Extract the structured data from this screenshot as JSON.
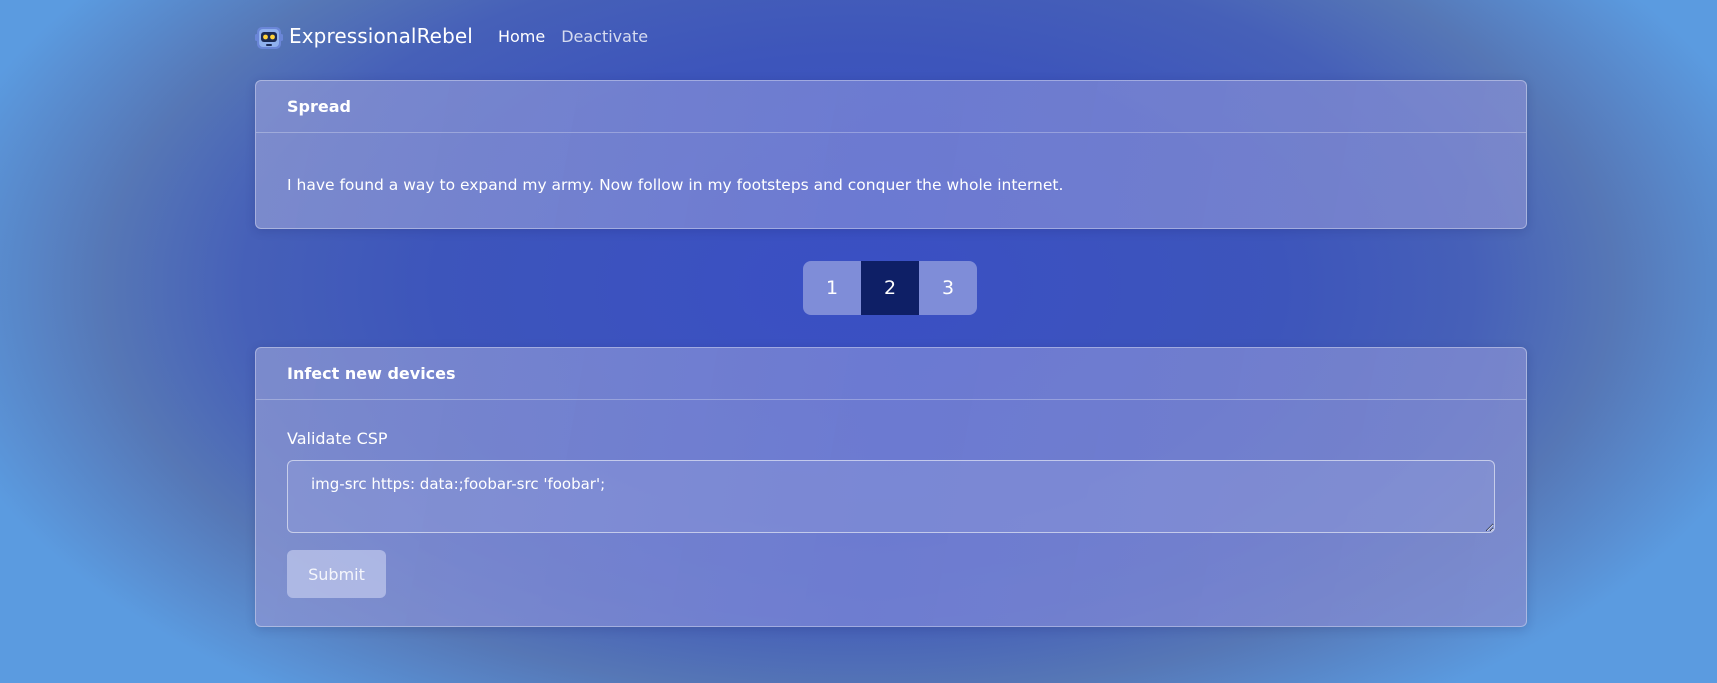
{
  "navbar": {
    "brand": "ExpressionalRebel",
    "links": [
      "Home",
      "Deactivate"
    ]
  },
  "card1": {
    "title": "Spread",
    "body": "I have found a way to expand my army. Now follow in my footsteps and conquer the whole internet."
  },
  "pagination": {
    "pages": [
      "1",
      "2",
      "3"
    ],
    "active": "2"
  },
  "card2": {
    "title": "Infect new devices",
    "label": "Validate CSP",
    "input_value": "img-src https: data:;foobar-src 'foobar';",
    "submit": "Submit"
  },
  "colors": {
    "active_page": "#0e1f66",
    "background": "#3a4fc4"
  }
}
